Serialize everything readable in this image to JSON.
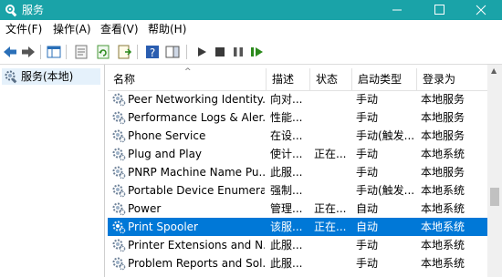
{
  "window": {
    "title": "服务",
    "app_icon": "services-gear-icon"
  },
  "menu": [
    "文件(F)",
    "操作(A)",
    "查看(V)",
    "帮助(H)"
  ],
  "toolbar": {
    "icons": [
      "back-arrow-icon",
      "forward-arrow-icon",
      "console-tree-icon",
      "properties-icon",
      "refresh-icon",
      "export-list-icon",
      "help-icon",
      "show-hide-icon",
      "start-service-icon",
      "stop-service-icon",
      "pause-service-icon",
      "restart-service-icon"
    ]
  },
  "tree": {
    "node_label": "服务(本地)"
  },
  "columns": [
    "名称",
    "描述",
    "状态",
    "启动类型",
    "登录为"
  ],
  "sort_indicator": "^",
  "services": [
    {
      "name": "Peer Networking Identity...",
      "desc": "向对...",
      "status": "",
      "startup": "手动",
      "logon": "本地服务",
      "selected": false
    },
    {
      "name": "Performance Logs & Aler...",
      "desc": "性能...",
      "status": "",
      "startup": "手动",
      "logon": "本地服务",
      "selected": false
    },
    {
      "name": "Phone Service",
      "desc": "在设...",
      "status": "",
      "startup": "手动(触发...",
      "logon": "本地服务",
      "selected": false
    },
    {
      "name": "Plug and Play",
      "desc": "使计...",
      "status": "正在...",
      "startup": "手动",
      "logon": "本地系统",
      "selected": false
    },
    {
      "name": "PNRP Machine Name Pu...",
      "desc": "此服...",
      "status": "",
      "startup": "手动",
      "logon": "本地服务",
      "selected": false
    },
    {
      "name": "Portable Device Enumera...",
      "desc": "强制...",
      "status": "",
      "startup": "手动(触发...",
      "logon": "本地系统",
      "selected": false
    },
    {
      "name": "Power",
      "desc": "管理...",
      "status": "正在...",
      "startup": "自动",
      "logon": "本地系统",
      "selected": false
    },
    {
      "name": "Print Spooler",
      "desc": "该服...",
      "status": "正在...",
      "startup": "自动",
      "logon": "本地系统",
      "selected": true
    },
    {
      "name": "Printer Extensions and N...",
      "desc": "此服...",
      "status": "",
      "startup": "手动",
      "logon": "本地系统",
      "selected": false
    },
    {
      "name": "Problem Reports and Sol...",
      "desc": "此服...",
      "status": "",
      "startup": "手动",
      "logon": "本地系统",
      "selected": false
    }
  ],
  "colors": {
    "titlebar": "#1aa3a8",
    "selection": "#0078d7",
    "tree_selection": "#e5f1fb"
  }
}
